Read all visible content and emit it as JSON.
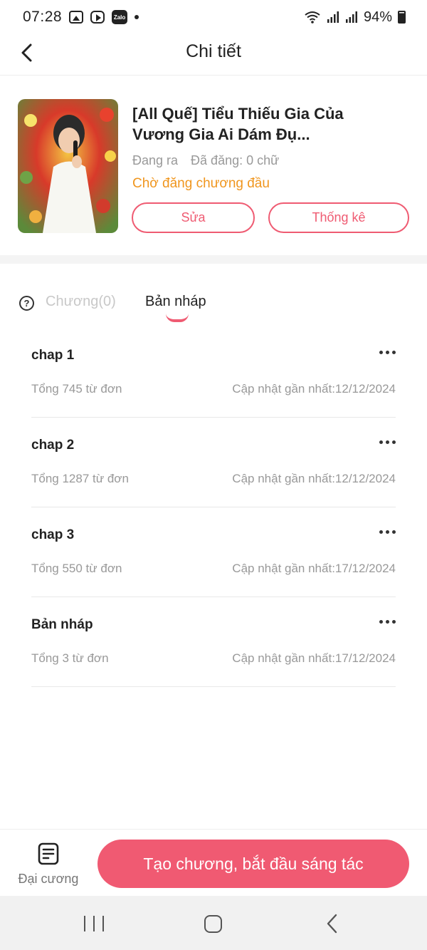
{
  "status_bar": {
    "time": "07:28",
    "zalo_label": "Zalo",
    "battery": "94%"
  },
  "header": {
    "title": "Chi tiết"
  },
  "book": {
    "title": "[All Quế] Tiểu Thiếu Gia Của Vương Gia Ai Dám Đụ...",
    "status": "Đang ra",
    "published": "Đã đăng: 0 chữ",
    "chapter_state": "Chờ đăng chương đầu",
    "edit_label": "Sửa",
    "stats_label": "Thống kê"
  },
  "tabs": {
    "chapters": "Chương(0)",
    "drafts": "Bản nháp",
    "active": "drafts"
  },
  "drafts": [
    {
      "name": "chap 1",
      "words": "Tổng 745 từ đơn",
      "updated": "Cập nhật gần nhất:12/12/2024"
    },
    {
      "name": "chap 2",
      "words": "Tổng 1287 từ đơn",
      "updated": "Cập nhật gần nhất:12/12/2024"
    },
    {
      "name": "chap 3",
      "words": "Tổng 550 từ đơn",
      "updated": "Cập nhật gần nhất:17/12/2024"
    },
    {
      "name": "Bản nháp",
      "words": "Tổng 3 từ đơn",
      "updated": "Cập nhật gần nhất:17/12/2024"
    }
  ],
  "bottom": {
    "outline_label": "Đại cương",
    "create_label": "Tạo chương, bắt đầu sáng tác"
  },
  "colors": {
    "accent": "#ef5b72",
    "status_orange": "#f0961e",
    "muted": "#999999"
  }
}
